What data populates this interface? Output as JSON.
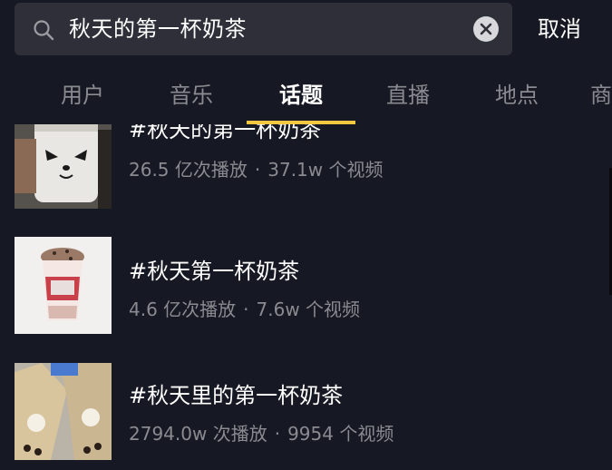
{
  "search": {
    "query": "秋天的第一杯奶茶",
    "cancel_label": "取消"
  },
  "tabs": [
    {
      "label": "用户",
      "active": false
    },
    {
      "label": "音乐",
      "active": false
    },
    {
      "label": "话题",
      "active": true
    },
    {
      "label": "直播",
      "active": false
    },
    {
      "label": "地点",
      "active": false
    },
    {
      "label": "商",
      "active": false
    }
  ],
  "results": [
    {
      "title": "#秋天的第一杯奶茶",
      "plays": "26.5 亿次播放",
      "videos": "37.1w 个视频"
    },
    {
      "title": "#秋天第一杯奶茶",
      "plays": "4.6 亿次播放",
      "videos": "7.6w 个视频"
    },
    {
      "title": "#秋天里的第一杯奶茶",
      "plays": "2794.0w 次播放",
      "videos": "9954 个视频"
    }
  ],
  "stats_separator": "·",
  "colors": {
    "background": "#161823",
    "search_bg": "#2e2f38",
    "accent": "#f5c842",
    "muted_text": "#8a8b91"
  }
}
